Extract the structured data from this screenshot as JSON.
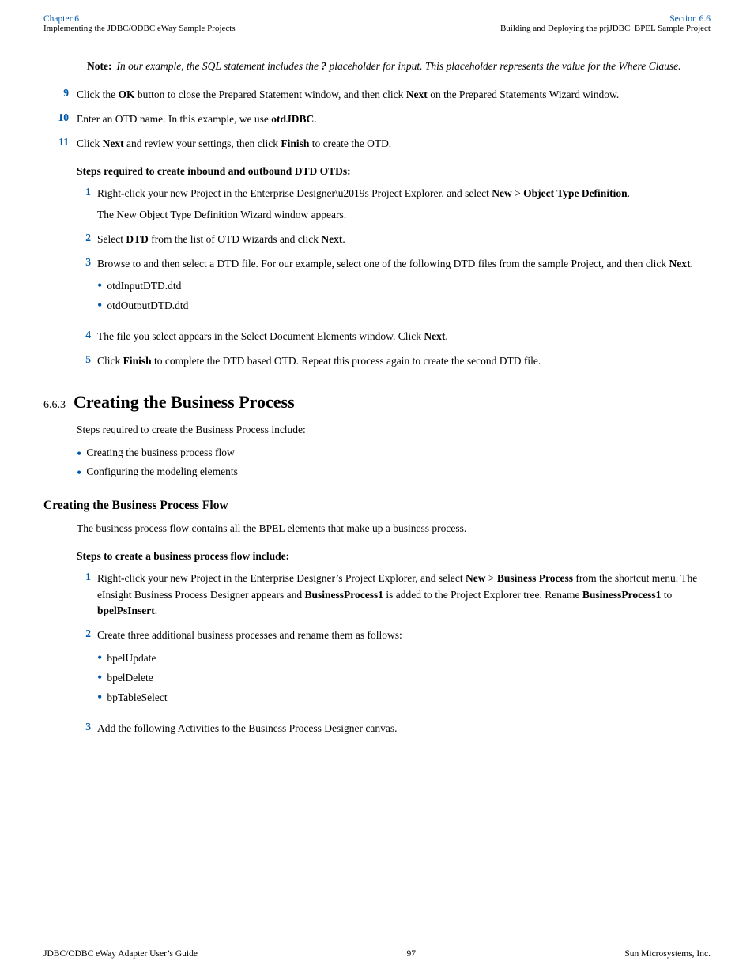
{
  "header": {
    "left_label": "Chapter 6",
    "left_sub": "Implementing the JDBC/ODBC eWay Sample Projects",
    "right_label": "Section 6.6",
    "right_sub": "Building and Deploying the prjJDBC_BPEL Sample Project"
  },
  "note": {
    "label": "Note:",
    "text": "In our example, the SQL statement includes the ? placeholder for input. This placeholder represents the value for the Where Clause."
  },
  "main_steps": [
    {
      "num": "9",
      "text_html": "Click the <b>OK</b> button to close the Prepared Statement window, and then click <b>Next</b> on the Prepared Statements Wizard window."
    },
    {
      "num": "10",
      "text_html": "Enter an OTD name. In this example, we use <b>otdJDBC</b>."
    },
    {
      "num": "11",
      "text_html": "Click <b>Next</b> and review your settings, then click <b>Finish</b> to create the OTD."
    }
  ],
  "steps_dtd_heading": "Steps required to create inbound and outbound DTD OTDs:",
  "dtd_steps": [
    {
      "num": "1",
      "text_html": "Right-click your new Project in the Enterprise Designer’s Project Explorer, and select <b>New</b> &gt; <b>Object Type Definition</b>.",
      "sub_text": "The New Object Type Definition Wizard window appears.",
      "bullets": []
    },
    {
      "num": "2",
      "text_html": "Select <b>DTD</b> from the list of OTD Wizards and click <b>Next</b>.",
      "sub_text": "",
      "bullets": []
    },
    {
      "num": "3",
      "text_html": "Browse to and then select a DTD file. For our example, select one of the following DTD files from the sample Project, and then click <b>Next</b>.",
      "sub_text": "",
      "bullets": [
        "otdInputDTD.dtd",
        "otdOutputDTD.dtd"
      ]
    },
    {
      "num": "4",
      "text_html": "The file you select appears in the Select Document Elements window. Click <b>Next</b>.",
      "sub_text": "",
      "bullets": []
    },
    {
      "num": "5",
      "text_html": "Click <b>Finish</b> to complete the DTD based OTD. Repeat this process again to create the second DTD file.",
      "sub_text": "",
      "bullets": []
    }
  ],
  "section_663": {
    "num": "6.6.3",
    "title": "Creating the Business Process",
    "intro": "Steps required to create the Business Process include:",
    "bullets": [
      "Creating the business process flow",
      "Configuring the modeling elements"
    ]
  },
  "subsection_flow": {
    "title": "Creating the Business Process Flow",
    "para1": "The business process flow contains all the BPEL elements that make up a business process.",
    "steps_heading": "Steps to create a business process flow include:",
    "steps": [
      {
        "num": "1",
        "text_html": "Right-click your new Project in the Enterprise Designer’s Project Explorer, and select <b>New</b> &gt; <b>Business Process</b> from the shortcut menu. The eInsight Business Process Designer appears and <b>BusinessProcess1</b> is added to the Project Explorer tree. Rename <b>BusinessProcess1</b> to <b>bpelPsInsert</b>."
      },
      {
        "num": "2",
        "text_html": "Create three additional business processes and rename them as follows:",
        "bullets": [
          "bpelUpdate",
          "bpelDelete",
          "bpTableSelect"
        ]
      },
      {
        "num": "3",
        "text_html": "Add the following Activities to the Business Process Designer canvas."
      }
    ]
  },
  "footer": {
    "left": "JDBC/ODBC eWay Adapter User’s Guide",
    "center": "97",
    "right": "Sun Microsystems, Inc."
  }
}
